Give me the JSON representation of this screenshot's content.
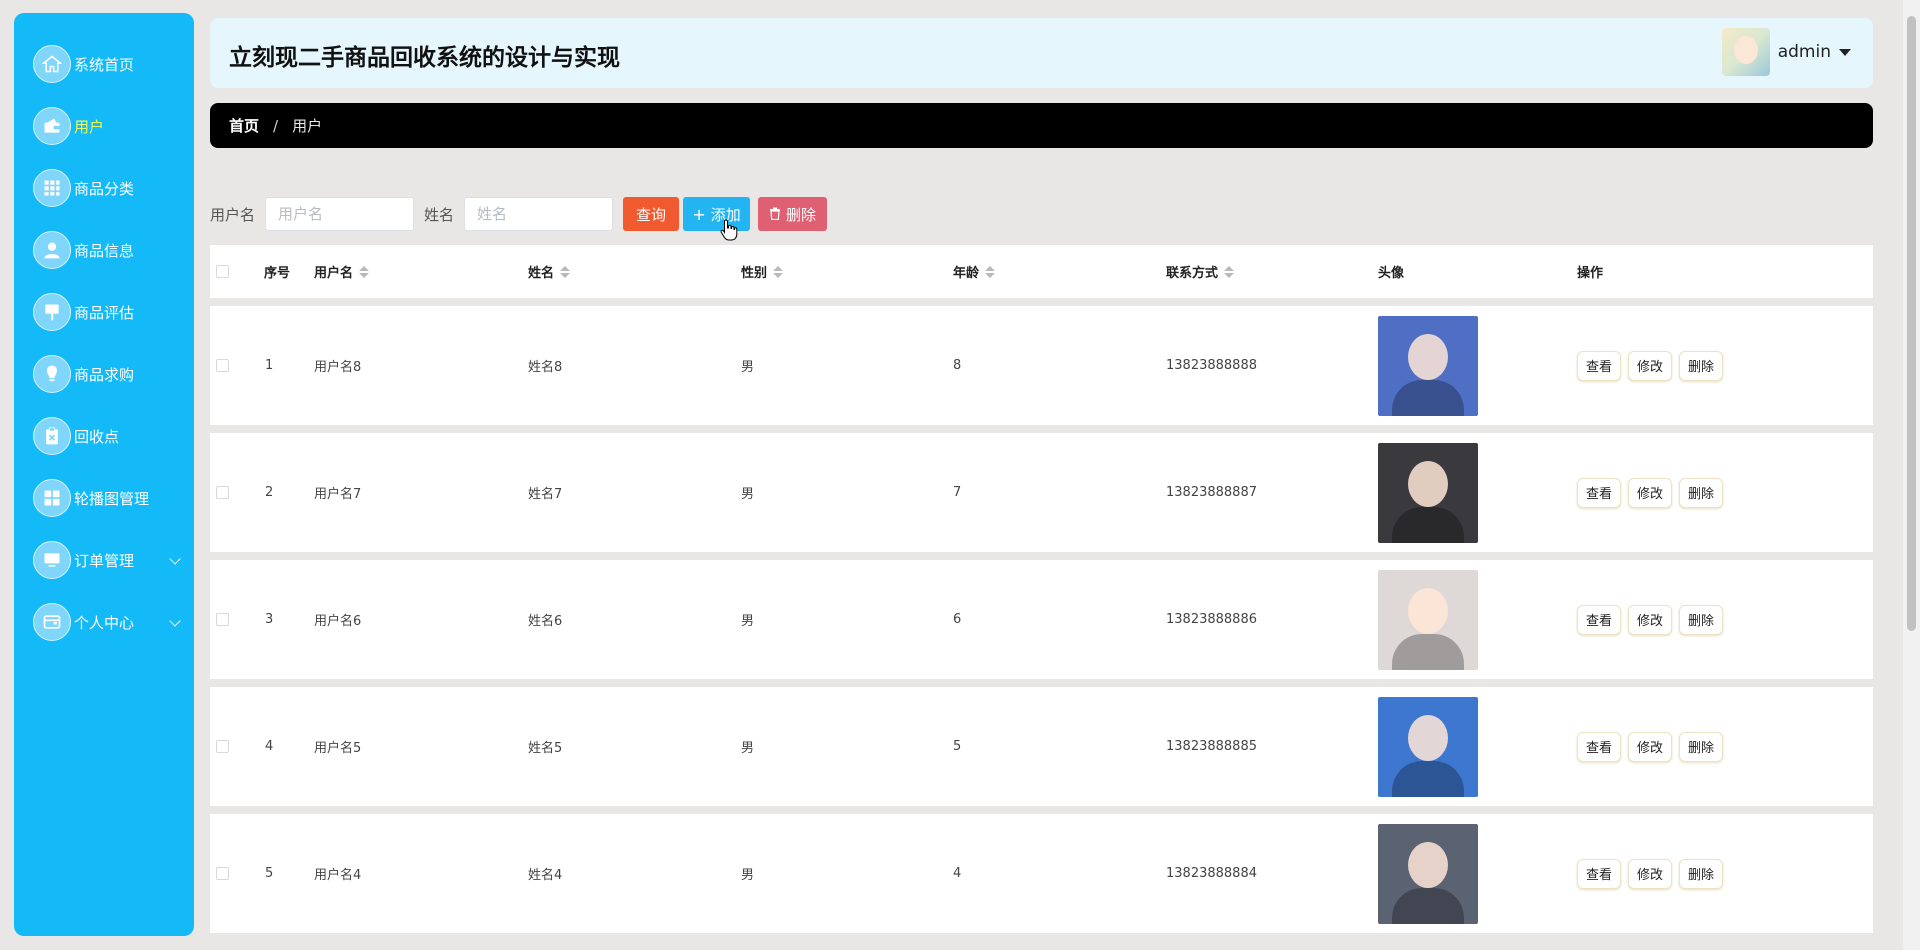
{
  "sidebar": {
    "items": [
      {
        "label": "系统首页",
        "icon": "home-icon",
        "active": false,
        "has_submenu": false
      },
      {
        "label": "用户",
        "icon": "wallet-icon",
        "active": true,
        "has_submenu": false
      },
      {
        "label": "商品分类",
        "icon": "grid-icon",
        "active": false,
        "has_submenu": false
      },
      {
        "label": "商品信息",
        "icon": "person-icon",
        "active": false,
        "has_submenu": false
      },
      {
        "label": "商品评估",
        "icon": "sign-icon",
        "active": false,
        "has_submenu": false
      },
      {
        "label": "商品求购",
        "icon": "bulb-icon",
        "active": false,
        "has_submenu": false
      },
      {
        "label": "回收点",
        "icon": "clipboard-icon",
        "active": false,
        "has_submenu": false
      },
      {
        "label": "轮播图管理",
        "icon": "tiles-icon",
        "active": false,
        "has_submenu": false
      },
      {
        "label": "订单管理",
        "icon": "monitor-icon",
        "active": false,
        "has_submenu": true
      },
      {
        "label": "个人中心",
        "icon": "card-icon",
        "active": false,
        "has_submenu": true
      }
    ]
  },
  "header": {
    "title": "立刻现二手商品回收系统的设计与实现",
    "user_name": "admin"
  },
  "breadcrumb": {
    "home": "首页",
    "separator": "/",
    "current": "用户"
  },
  "search": {
    "username_label": "用户名",
    "username_placeholder": "用户名",
    "name_label": "姓名",
    "name_placeholder": "姓名",
    "query_label": "查询",
    "add_label": "添加",
    "delete_label": "删除"
  },
  "table": {
    "columns": {
      "index": "序号",
      "username": "用户名",
      "name": "姓名",
      "gender": "性别",
      "age": "年龄",
      "contact": "联系方式",
      "avatar": "头像",
      "actions": "操作"
    },
    "actions": {
      "view": "查看",
      "edit": "修改",
      "delete": "删除"
    },
    "rows": [
      {
        "index": "1",
        "username": "用户名8",
        "name": "姓名8",
        "gender": "男",
        "age": "8",
        "contact": "13823888888"
      },
      {
        "index": "2",
        "username": "用户名7",
        "name": "姓名7",
        "gender": "男",
        "age": "7",
        "contact": "13823888887"
      },
      {
        "index": "3",
        "username": "用户名6",
        "name": "姓名6",
        "gender": "男",
        "age": "6",
        "contact": "13823888886"
      },
      {
        "index": "4",
        "username": "用户名5",
        "name": "姓名5",
        "gender": "男",
        "age": "5",
        "contact": "13823888885"
      },
      {
        "index": "5",
        "username": "用户名4",
        "name": "姓名4",
        "gender": "男",
        "age": "4",
        "contact": "13823888884"
      }
    ]
  },
  "colors": {
    "sidebar_bg": "#14b9f8",
    "active_menu": "#eaff5c",
    "query_btn": "#f05a2e",
    "add_btn": "#23b4f2",
    "delete_btn": "#de6072"
  }
}
